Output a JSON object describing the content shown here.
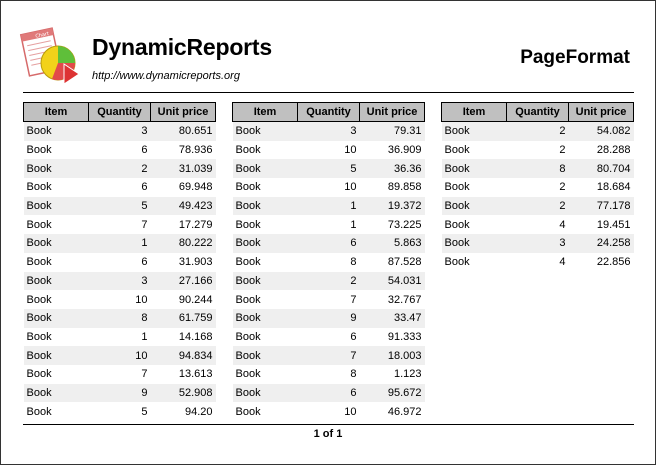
{
  "header": {
    "brand": "DynamicReports",
    "url": "http://www.dynamicreports.org",
    "title": "PageFormat"
  },
  "columns": {
    "item": "Item",
    "quantity": "Quantity",
    "unit_price": "Unit price"
  },
  "rows": [
    {
      "item": "Book",
      "quantity": "3",
      "unit_price": "80.651"
    },
    {
      "item": "Book",
      "quantity": "6",
      "unit_price": "78.936"
    },
    {
      "item": "Book",
      "quantity": "2",
      "unit_price": "31.039"
    },
    {
      "item": "Book",
      "quantity": "6",
      "unit_price": "69.948"
    },
    {
      "item": "Book",
      "quantity": "5",
      "unit_price": "49.423"
    },
    {
      "item": "Book",
      "quantity": "7",
      "unit_price": "17.279"
    },
    {
      "item": "Book",
      "quantity": "1",
      "unit_price": "80.222"
    },
    {
      "item": "Book",
      "quantity": "6",
      "unit_price": "31.903"
    },
    {
      "item": "Book",
      "quantity": "3",
      "unit_price": "27.166"
    },
    {
      "item": "Book",
      "quantity": "10",
      "unit_price": "90.244"
    },
    {
      "item": "Book",
      "quantity": "8",
      "unit_price": "61.759"
    },
    {
      "item": "Book",
      "quantity": "1",
      "unit_price": "14.168"
    },
    {
      "item": "Book",
      "quantity": "10",
      "unit_price": "94.834"
    },
    {
      "item": "Book",
      "quantity": "7",
      "unit_price": "13.613"
    },
    {
      "item": "Book",
      "quantity": "9",
      "unit_price": "52.908"
    },
    {
      "item": "Book",
      "quantity": "5",
      "unit_price": "94.20"
    },
    {
      "item": "Book",
      "quantity": "3",
      "unit_price": "79.31"
    },
    {
      "item": "Book",
      "quantity": "10",
      "unit_price": "36.909"
    },
    {
      "item": "Book",
      "quantity": "5",
      "unit_price": "36.36"
    },
    {
      "item": "Book",
      "quantity": "10",
      "unit_price": "89.858"
    },
    {
      "item": "Book",
      "quantity": "1",
      "unit_price": "19.372"
    },
    {
      "item": "Book",
      "quantity": "1",
      "unit_price": "73.225"
    },
    {
      "item": "Book",
      "quantity": "6",
      "unit_price": "5.863"
    },
    {
      "item": "Book",
      "quantity": "8",
      "unit_price": "87.528"
    },
    {
      "item": "Book",
      "quantity": "2",
      "unit_price": "54.031"
    },
    {
      "item": "Book",
      "quantity": "7",
      "unit_price": "32.767"
    },
    {
      "item": "Book",
      "quantity": "9",
      "unit_price": "33.47"
    },
    {
      "item": "Book",
      "quantity": "6",
      "unit_price": "91.333"
    },
    {
      "item": "Book",
      "quantity": "7",
      "unit_price": "18.003"
    },
    {
      "item": "Book",
      "quantity": "8",
      "unit_price": "1.123"
    },
    {
      "item": "Book",
      "quantity": "6",
      "unit_price": "95.672"
    },
    {
      "item": "Book",
      "quantity": "10",
      "unit_price": "46.972"
    },
    {
      "item": "Book",
      "quantity": "2",
      "unit_price": "54.082"
    },
    {
      "item": "Book",
      "quantity": "2",
      "unit_price": "28.288"
    },
    {
      "item": "Book",
      "quantity": "8",
      "unit_price": "80.704"
    },
    {
      "item": "Book",
      "quantity": "2",
      "unit_price": "18.684"
    },
    {
      "item": "Book",
      "quantity": "2",
      "unit_price": "77.178"
    },
    {
      "item": "Book",
      "quantity": "4",
      "unit_price": "19.451"
    },
    {
      "item": "Book",
      "quantity": "3",
      "unit_price": "24.258"
    },
    {
      "item": "Book",
      "quantity": "4",
      "unit_price": "22.856"
    }
  ],
  "footer": {
    "page_indicator": "1 of 1"
  },
  "colors": {
    "header_background": "#c0c0c0",
    "row_stripe": "#efefef"
  },
  "logo": {
    "icon": "report-chart-icon",
    "text": "Chart"
  }
}
